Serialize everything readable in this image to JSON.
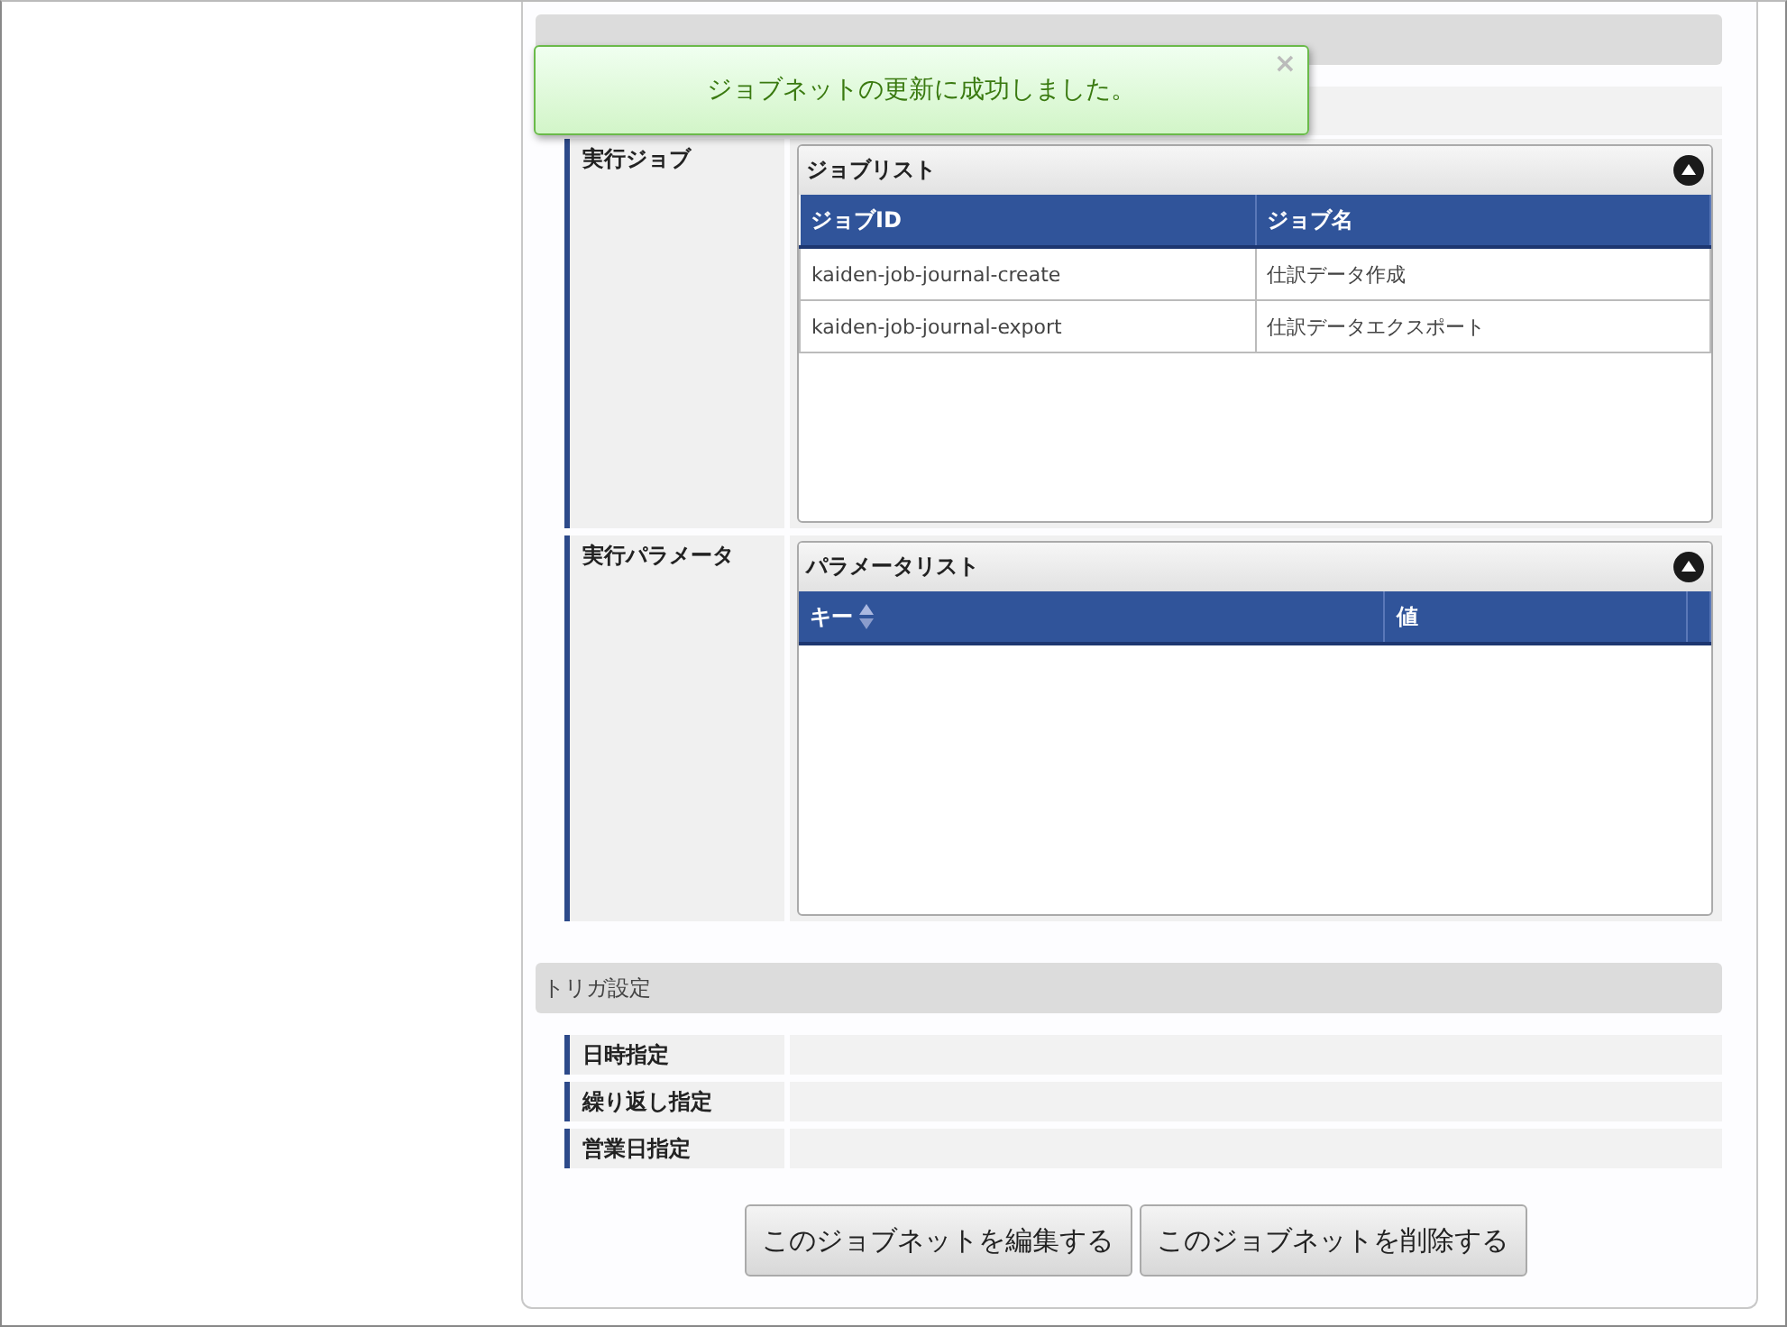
{
  "notification": {
    "message": "ジョブネットの更新に成功しました。",
    "close": "×"
  },
  "runtime_rows": [
    {
      "label": "実行ジョブ",
      "list": {
        "title": "ジョブリスト",
        "columns": [
          {
            "label": "ジョブID",
            "sortable": false
          },
          {
            "label": "ジョブ名",
            "sortable": false
          }
        ],
        "rows": [
          [
            "kaiden-job-journal-create",
            "仕訳データ作成"
          ],
          [
            "kaiden-job-journal-export",
            "仕訳データエクスポート"
          ]
        ]
      }
    },
    {
      "label": "実行パラメータ",
      "list": {
        "title": "パラメータリスト",
        "columns": [
          {
            "label": "キー",
            "sortable": true
          },
          {
            "label": "値",
            "sortable": false
          }
        ]
      }
    }
  ],
  "trigger_section": {
    "title": "トリガ設定",
    "rows": [
      {
        "label": "日時指定"
      },
      {
        "label": "繰り返し指定"
      },
      {
        "label": "営業日指定"
      }
    ]
  },
  "buttons": [
    "このジョブネットを編集する",
    "このジョブネットを削除する"
  ]
}
